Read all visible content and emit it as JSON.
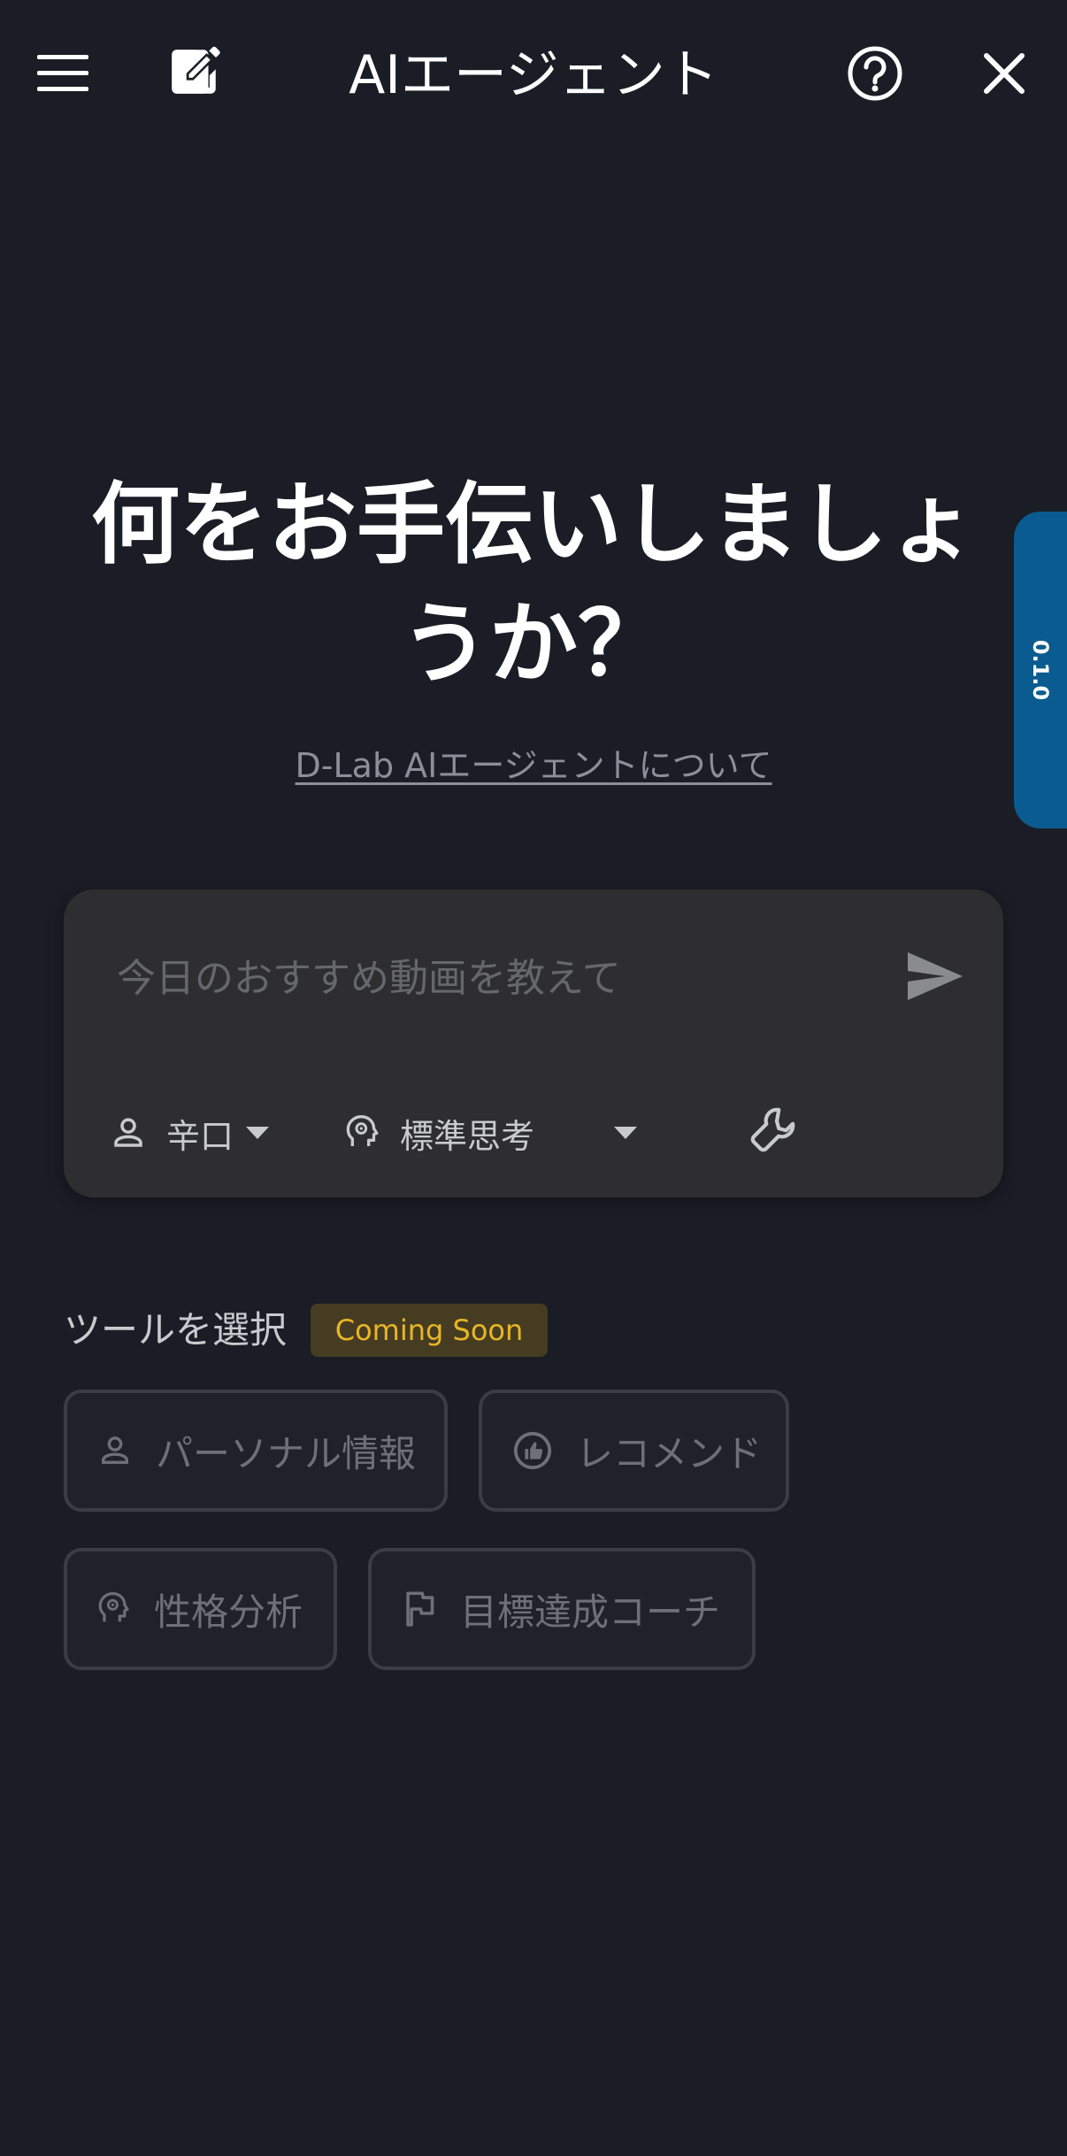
{
  "header": {
    "title": "AIエージェント",
    "menu_icon": "hamburger-menu-icon",
    "new_chat_icon": "edit-icon",
    "help_icon": "help-circle-icon",
    "close_icon": "close-icon"
  },
  "hero": {
    "title": "何をお手伝いしましょうか？",
    "about_link": "D-Lab AIエージェントについて"
  },
  "side_tab": {
    "label": "0.1.0"
  },
  "composer": {
    "placeholder": "今日のおすすめ動画を教えて",
    "value": "",
    "send_icon": "send-icon",
    "persona": {
      "icon": "person-icon",
      "selected": "辛口"
    },
    "thinking_mode": {
      "icon": "head-gear-icon",
      "selected": "標準思考"
    },
    "tools_icon": "wrench-icon"
  },
  "tools": {
    "label": "ツールを選択",
    "badge": "Coming Soon",
    "items": [
      {
        "label": "パーソナル情報",
        "icon": "person-icon"
      },
      {
        "label": "レコメンド",
        "icon": "thumbs-up-icon"
      },
      {
        "label": "性格分析",
        "icon": "head-gear-icon"
      },
      {
        "label": "目標達成コーチ",
        "icon": "flag-icon"
      }
    ]
  },
  "colors": {
    "background": "#1a1d25",
    "card": "#2e2e30",
    "side_tab": "#0a5b8f",
    "badge_text": "#e8b625",
    "badge_bg": "#463c22"
  }
}
